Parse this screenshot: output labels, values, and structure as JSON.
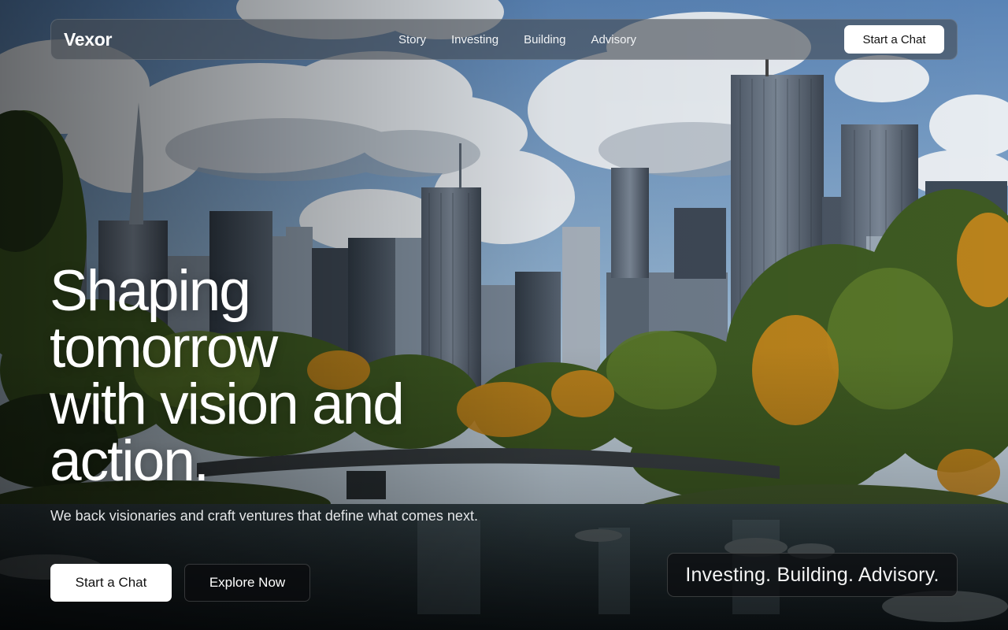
{
  "nav": {
    "logo": "Vexor",
    "links": [
      "Story",
      "Investing",
      "Building",
      "Advisory"
    ],
    "cta_label": "Start a Chat"
  },
  "hero": {
    "title_lines": [
      "Shaping",
      "tomorrow",
      "with vision and",
      "action."
    ],
    "subtitle": "We back visionaries and craft ventures that define what comes next.",
    "primary_cta": "Start a Chat",
    "secondary_cta": "Explore Now",
    "tagline": "Investing. Building. Advisory."
  },
  "colors": {
    "sky_top": "#5d86b8",
    "sky_bottom": "#c9d7e3",
    "foliage": "#3f5f23",
    "foliage_autumn": "#c8861a",
    "water": "#1c2a30",
    "button_light": "#ffffff",
    "button_dark": "#0a0c0e"
  }
}
